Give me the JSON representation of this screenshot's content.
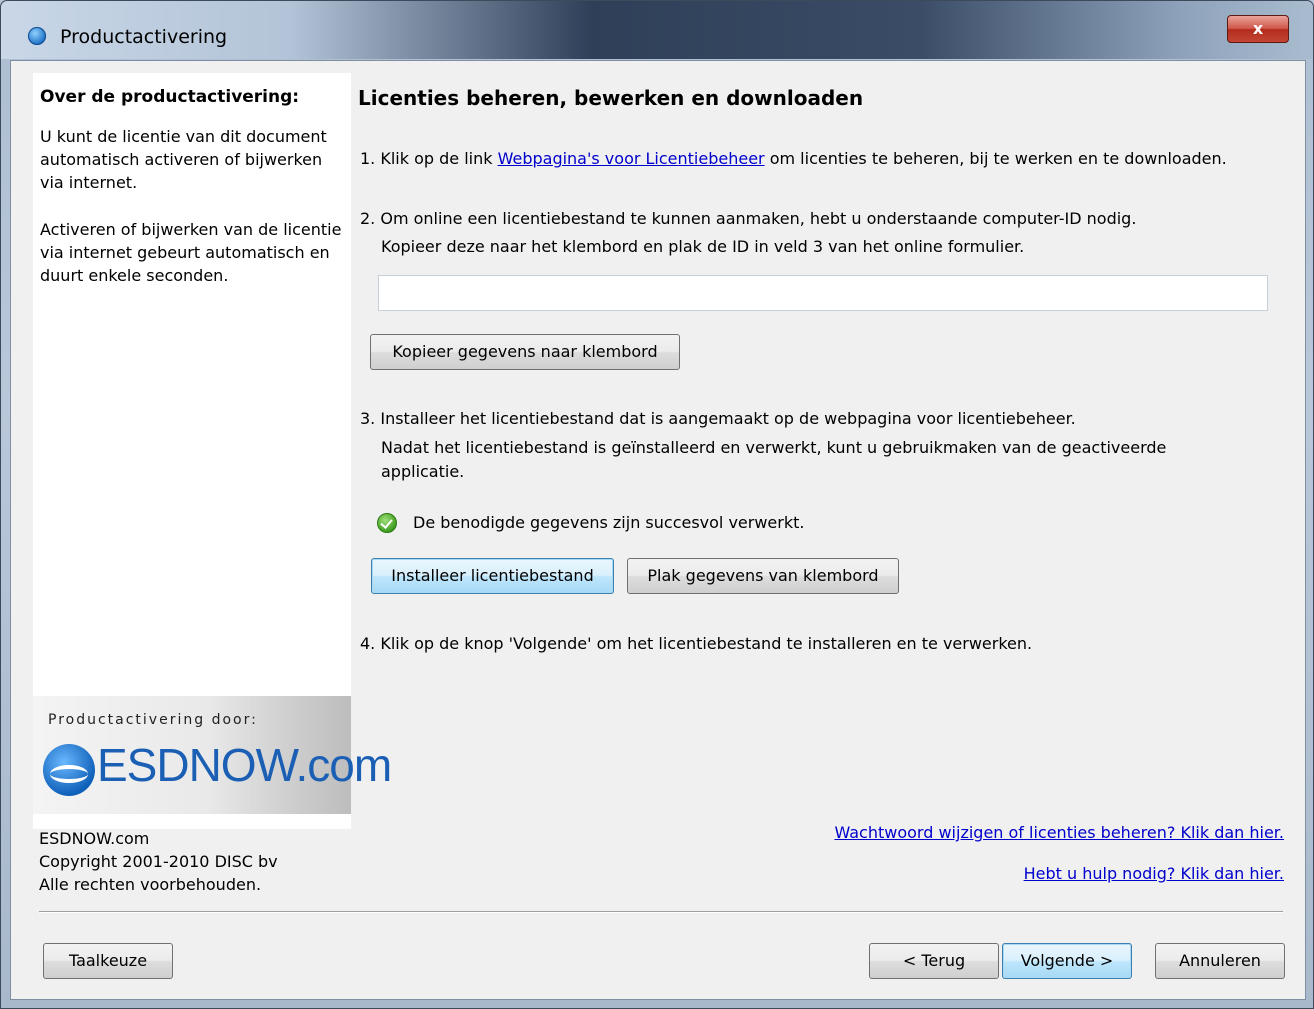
{
  "window": {
    "title": "Productactivering",
    "close_label": "x"
  },
  "left": {
    "title": "Over de productactivering:",
    "para1": "U kunt de licentie van dit document automatisch activeren of bijwerken via internet.",
    "para2": "Activeren of bijwerken van de licentie via internet gebeurt automatisch en duurt enkele seconden.",
    "logo_caption": "Productactivering door:",
    "logo_text": "ESDNOW.com",
    "footer_line1": "ESDNOW.com",
    "footer_line2": "Copyright 2001-2010 DISC bv",
    "footer_line3": "Alle rechten voorbehouden."
  },
  "main": {
    "heading": "Licenties beheren, bewerken en downloaden",
    "step1_prefix": "1. Klik op de link ",
    "step1_link": "Webpagina's voor Licentiebeheer",
    "step1_suffix": " om licenties te beheren, bij te werken en te downloaden.",
    "step2_line1": "2. Om online een licentiebestand te kunnen aanmaken, hebt u onderstaande computer-ID nodig.",
    "step2_line2": "Kopieer deze naar het klembord en plak de ID in veld 3 van het online formulier.",
    "computer_id_value": "",
    "copy_button": "Kopieer gegevens naar klembord",
    "step3_line1": "3. Installeer het licentiebestand dat is aangemaakt op de webpagina voor licentiebeheer.",
    "step3_line2": "Nadat het licentiebestand is geïnstalleerd en verwerkt, kunt u gebruikmaken van de geactiveerde",
    "step3_line3": "applicatie.",
    "status_message": "De benodigde gegevens zijn succesvol verwerkt.",
    "install_button": "Installeer licentiebestand",
    "paste_button": "Plak gegevens van klembord",
    "step4": "4. Klik op de knop 'Volgende' om het licentiebestand te installeren en te verwerken.",
    "link_password": "Wachtwoord wijzigen of licenties beheren? Klik dan hier.",
    "link_help": "Hebt u hulp nodig? Klik dan hier."
  },
  "footer": {
    "language_button": "Taalkeuze",
    "back_button": "< Terug",
    "next_button": "Volgende >",
    "cancel_button": "Annuleren"
  }
}
